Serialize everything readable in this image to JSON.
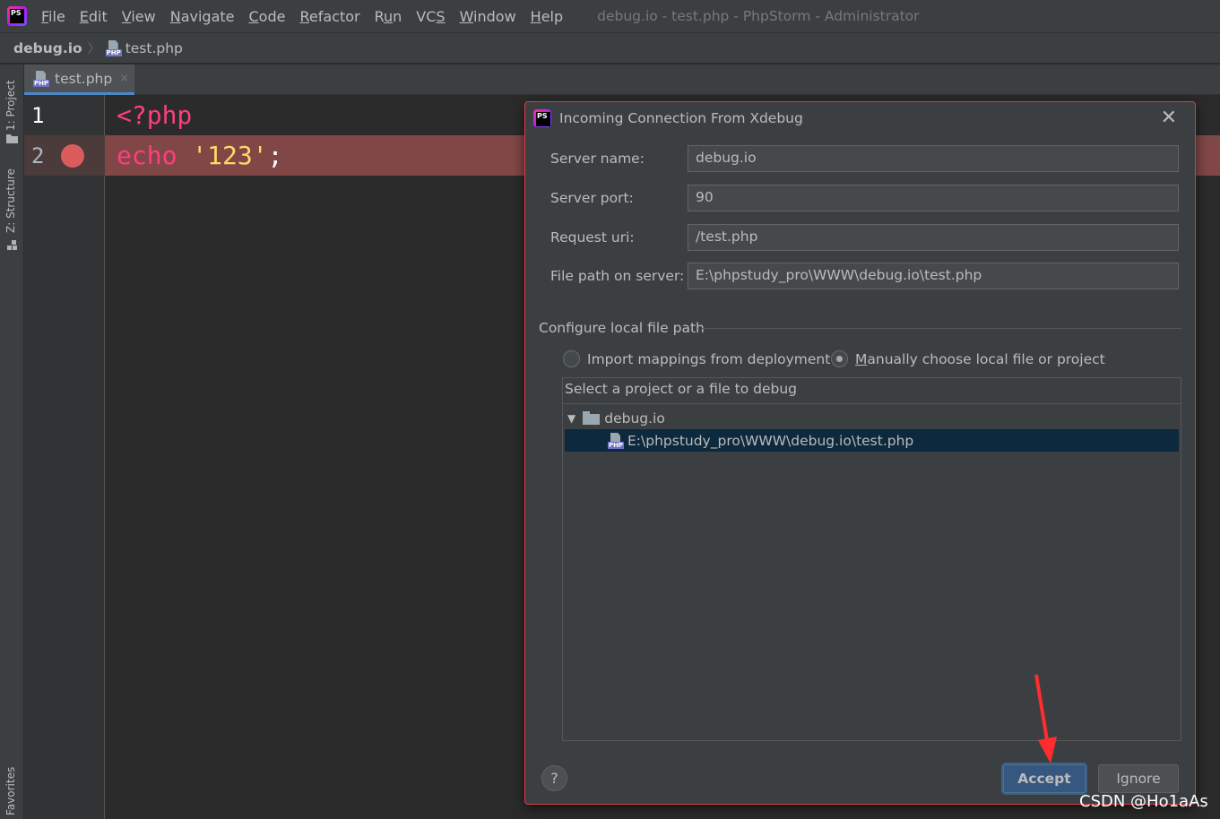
{
  "app": {
    "logo_text": "PS",
    "window_title": "debug.io - test.php - PhpStorm - Administrator"
  },
  "menu": [
    {
      "mnemonic": "F",
      "rest": "ile"
    },
    {
      "mnemonic": "E",
      "rest": "dit"
    },
    {
      "mnemonic": "V",
      "rest": "iew"
    },
    {
      "mnemonic": "N",
      "rest": "avigate"
    },
    {
      "mnemonic": "C",
      "rest": "ode"
    },
    {
      "mnemonic": "R",
      "rest": "efactor"
    },
    {
      "mnemonic": "",
      "pre": "R",
      "u": "u",
      "post": "n"
    },
    {
      "mnemonic": "",
      "pre": "VC",
      "u": "S",
      "post": ""
    },
    {
      "mnemonic": "W",
      "rest": "indow"
    },
    {
      "mnemonic": "H",
      "rest": "elp"
    }
  ],
  "breadcrumb": {
    "project": "debug.io",
    "file": "test.php"
  },
  "sidebar": {
    "project_tab": "1: Project",
    "structure_tab": "Z: Structure",
    "favorites_tab": "Favorites"
  },
  "editor": {
    "tab_label": "test.php",
    "tab_close": "×",
    "file_type_tag": "PHP",
    "lines": [
      {
        "number": "1",
        "open_tag": "<?php"
      },
      {
        "number": "2",
        "keyword": "echo",
        "string": "'123'",
        "terminator": ";"
      }
    ]
  },
  "dialog": {
    "title": "Incoming Connection From Xdebug",
    "close": "✕",
    "fields": [
      {
        "label": "Server name:",
        "value": "debug.io"
      },
      {
        "label": "Server port:",
        "value": "90"
      },
      {
        "label": "Request uri:",
        "value": "/test.php"
      },
      {
        "label": "File path on server:",
        "value": "E:\\phpstudy_pro\\WWW\\debug.io\\test.php"
      }
    ],
    "section_title": "Configure local file path",
    "radio_import": "Import mappings from deployment",
    "radio_manual_mnemonic": "M",
    "radio_manual_rest": "anually choose local file or project",
    "selected_option": "manual",
    "tree_caption": "Select a project or a file to debug",
    "tree": {
      "arrow": "▼",
      "root": "debug.io",
      "child": "E:\\phpstudy_pro\\WWW\\debug.io\\test.php"
    },
    "help": "?",
    "accept": "Accept",
    "ignore": "Ignore"
  },
  "watermark": "CSDN @Ho1aAs",
  "colors": {
    "accent": "#365880",
    "breakpoint_line": "#814747",
    "breakpoint": "#db5c5c",
    "annotation_arrow": "#ff2d2d",
    "dialog_border": "#e03a46"
  }
}
